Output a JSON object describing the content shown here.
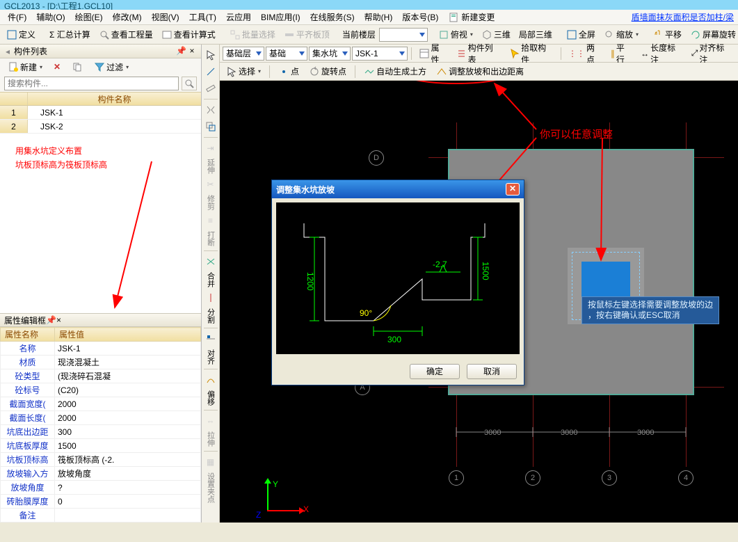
{
  "title_bar": "GCL2013 - [D:\\工程1.GCL10]",
  "menu": {
    "items": [
      "件(F)",
      "辅助(O)",
      "绘图(E)",
      "修改(M)",
      "视图(V)",
      "工具(T)",
      "云应用",
      "BIM应用(I)",
      "在线服务(S)",
      "帮助(H)",
      "版本号(B)"
    ],
    "new_change": "新建变更",
    "right_link": "盾墙面抹灰面积是否加柱/梁"
  },
  "toolbar1": {
    "define": "定义",
    "sum_calc": "Σ 汇总计算",
    "view_qty": "查看工程量",
    "view_formula": "查看计算式",
    "batch_select": "批量选择",
    "flat_slab": "平齐板顶",
    "cur_floor_lbl": "当前楼层",
    "cur_floor_val": "",
    "look": "俯视",
    "view3d": "三维",
    "local3d": "局部三维",
    "fullscreen": "全屏",
    "zoom": "缩放",
    "pan": "平移",
    "screen_rotate": "屏幕旋转"
  },
  "toolbar2": {
    "combo1": "基础层",
    "combo2": "基础",
    "combo3": "集水坑",
    "combo4": "JSK-1",
    "props": "属性",
    "member_list": "构件列表",
    "pick_member": "拾取构件",
    "two_point": "两点",
    "parallel": "平行",
    "len_dim": "长度标注",
    "align_dim": "对齐标注"
  },
  "toolbar3": {
    "select": "选择",
    "point": "点",
    "rotate_point": "旋转点",
    "auto_earth": "自动生成土方",
    "adjust_slope": "调整放坡和出边距离"
  },
  "left_panel": {
    "title": "构件列表",
    "new_btn": "新建",
    "filter": "过滤",
    "search_placeholder": "搜索构件...",
    "col_header": "构件名称",
    "rows": [
      {
        "num": "1",
        "name": "JSK-1"
      },
      {
        "num": "2",
        "name": "JSK-2"
      }
    ],
    "note_line1": "用集水坑定义布置",
    "note_line2": "坑板顶标高为筏板顶标高"
  },
  "prop_panel": {
    "title": "属性编辑框",
    "col_name": "属性名称",
    "col_value": "属性值",
    "rows": [
      {
        "n": "名称",
        "v": "JSK-1"
      },
      {
        "n": "材质",
        "v": "现浇混凝土"
      },
      {
        "n": "砼类型",
        "v": "(现浇碎石混凝"
      },
      {
        "n": "砼标号",
        "v": "(C20)"
      },
      {
        "n": "截面宽度(",
        "v": "2000"
      },
      {
        "n": "截面长度(",
        "v": "2000"
      },
      {
        "n": "坑底出边距",
        "v": "300"
      },
      {
        "n": "坑底板厚度",
        "v": "1500"
      },
      {
        "n": "坑板顶标高",
        "v": "筏板顶标高 (-2."
      },
      {
        "n": "放坡输入方",
        "v": "放坡角度"
      },
      {
        "n": "放坡角度",
        "v": "?"
      },
      {
        "n": "砖胎膜厚度",
        "v": "0"
      }
    ],
    "remark": "备注"
  },
  "toolbox": {
    "labels": [
      "延伸",
      "修剪",
      "打断",
      "合并",
      "分割",
      "对齐",
      "偏移",
      "拉伸",
      "设置夹点"
    ]
  },
  "canvas": {
    "grid_axes_top": [
      "D",
      "A"
    ],
    "grid_axes_bottom": [
      "1",
      "2",
      "3",
      "4"
    ],
    "dims": [
      "3000",
      "3000",
      "3000"
    ],
    "tooltip_line1": "按鼠标左键选择需要调整放坡的边",
    "tooltip_line2": "，按右键确认或ESC取消",
    "red_note": "你可以任意调整",
    "ucs": {
      "x": "X",
      "y": "Y",
      "z": "Z"
    }
  },
  "dialog": {
    "title": "调整集水坑放坡",
    "dim_1200": "1200",
    "dim_1500": "1500",
    "dim_300": "300",
    "dim_neg27": "-2.7",
    "angle_90": "90°",
    "ok": "确定",
    "cancel": "取消"
  },
  "chart_data": {
    "type": "table",
    "title": "属性编辑框",
    "columns": [
      "属性名称",
      "属性值"
    ],
    "rows": [
      [
        "名称",
        "JSK-1"
      ],
      [
        "材质",
        "现浇混凝土"
      ],
      [
        "砼类型",
        "(现浇碎石混凝"
      ],
      [
        "砼标号",
        "(C20)"
      ],
      [
        "截面宽度(",
        "2000"
      ],
      [
        "截面长度(",
        "2000"
      ],
      [
        "坑底出边距",
        "300"
      ],
      [
        "坑底板厚度",
        "1500"
      ],
      [
        "坑板顶标高",
        "筏板顶标高 (-2."
      ],
      [
        "放坡输入方",
        "放坡角度"
      ],
      [
        "放坡角度",
        "?"
      ],
      [
        "砖胎膜厚度",
        "0"
      ]
    ]
  }
}
